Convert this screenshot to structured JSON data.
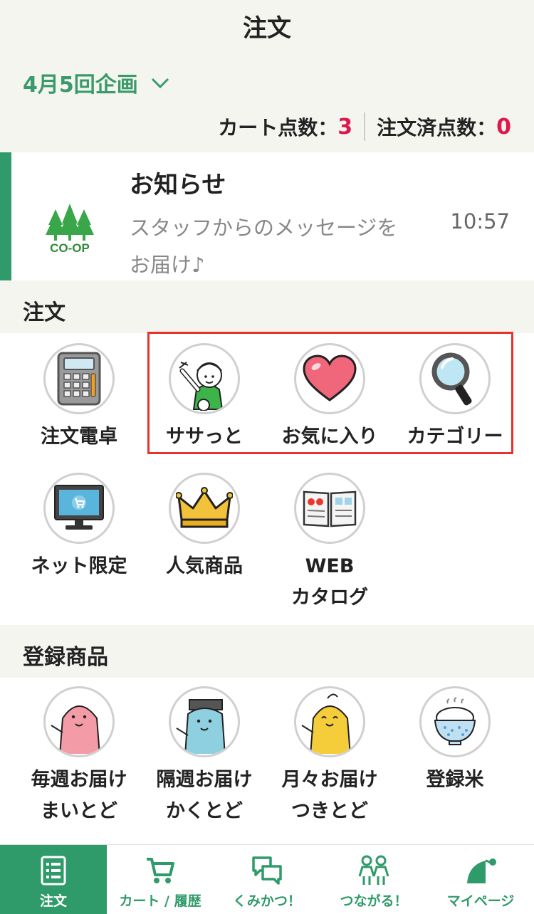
{
  "header": {
    "title": "注文"
  },
  "plan": {
    "label": "4月5回企画"
  },
  "counts": {
    "cart_label": "カート点数：",
    "cart_value": "3",
    "ordered_label": "注文済点数：",
    "ordered_value": "0"
  },
  "notice": {
    "logo_text": "CO-OP",
    "title": "お知らせ",
    "message_line1": "スタッフからのメッセージを",
    "message_line2": "お届け♪",
    "time": "10:57"
  },
  "order_section": {
    "heading": "注文",
    "items": [
      {
        "label": "注文電卓",
        "icon": "calculator-icon"
      },
      {
        "label": "ササっと",
        "icon": "pointing-character-icon"
      },
      {
        "label": "お気に入り",
        "icon": "heart-icon"
      },
      {
        "label": "カテゴリー",
        "icon": "magnifier-icon"
      },
      {
        "label": "ネット限定",
        "icon": "monitor-cart-icon"
      },
      {
        "label": "人気商品",
        "icon": "crown-icon"
      },
      {
        "label1": "WEB",
        "label2": "カタログ",
        "icon": "catalog-icon"
      }
    ]
  },
  "registered_section": {
    "heading": "登録商品",
    "items": [
      {
        "label1": "毎週お届け",
        "label2": "まいとど",
        "icon": "pink-seal-icon",
        "color": "#f39ba6"
      },
      {
        "label1": "隔週お届け",
        "label2": "かくとど",
        "icon": "blue-seal-icon",
        "color": "#8fd0e0"
      },
      {
        "label1": "月々お届け",
        "label2": "つきとど",
        "icon": "yellow-seal-icon",
        "color": "#f5cc3a"
      },
      {
        "label1": "登録米",
        "icon": "rice-bowl-icon"
      }
    ]
  },
  "tabbar": {
    "tabs": [
      {
        "label": "注文",
        "icon": "order-list-icon",
        "active": true
      },
      {
        "label": "カート / 履歴",
        "icon": "cart-icon"
      },
      {
        "label": "くみかつ！",
        "icon": "chat-bubbles-icon"
      },
      {
        "label": "つながる！",
        "icon": "people-icon"
      },
      {
        "label": "マイページ",
        "icon": "mypage-icon"
      }
    ]
  },
  "colors": {
    "brand_green": "#2f9a6a",
    "count_red": "#e0174a",
    "highlight_red": "#e8322e"
  }
}
